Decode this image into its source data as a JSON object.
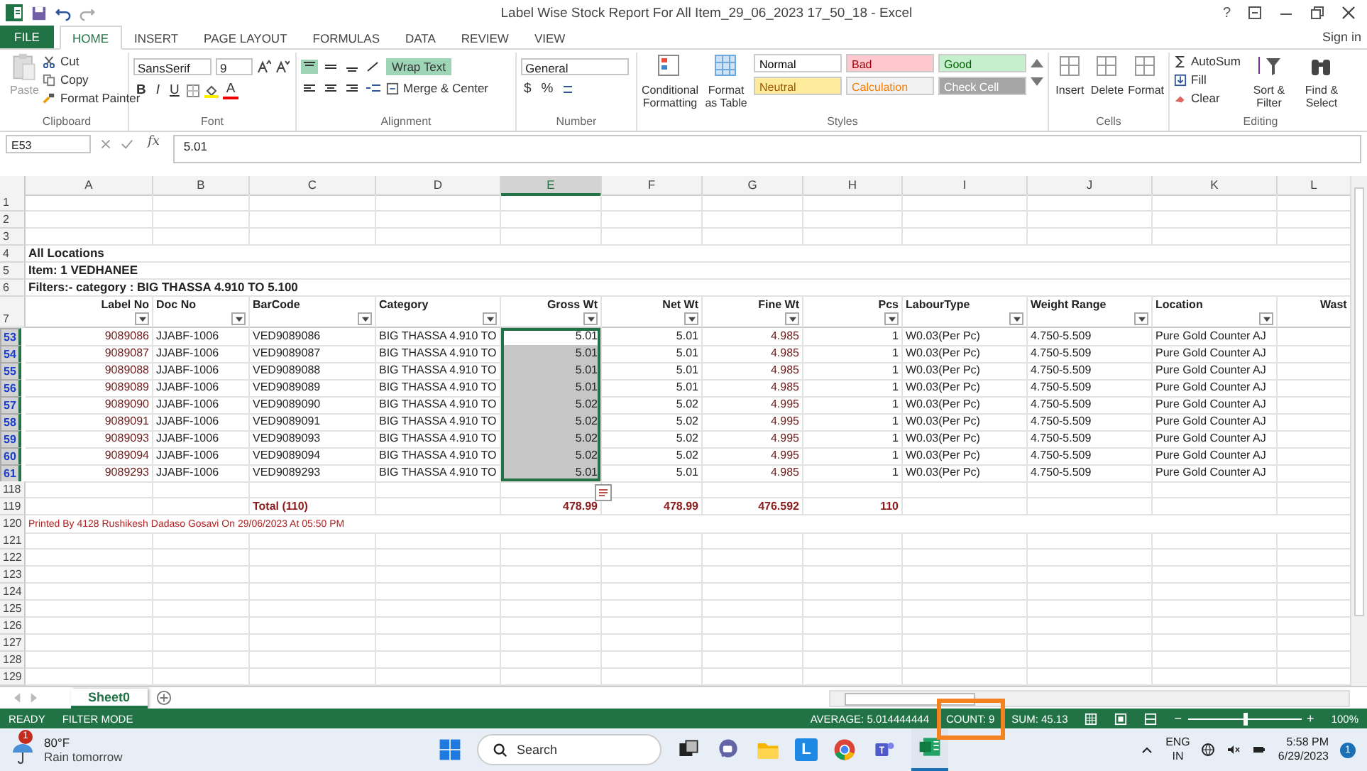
{
  "window": {
    "title": "Label Wise Stock Report For All Item_29_06_2023 17_50_18 - Excel",
    "help": "?",
    "sign_in": "Sign in"
  },
  "tabs": [
    {
      "label": "FILE",
      "kind": "file",
      "selected": false
    },
    {
      "label": "HOME",
      "kind": "tab",
      "selected": true
    },
    {
      "label": "INSERT",
      "kind": "tab",
      "selected": false
    },
    {
      "label": "PAGE LAYOUT",
      "kind": "tab",
      "selected": false
    },
    {
      "label": "FORMULAS",
      "kind": "tab",
      "selected": false
    },
    {
      "label": "DATA",
      "kind": "tab",
      "selected": false
    },
    {
      "label": "REVIEW",
      "kind": "tab",
      "selected": false
    },
    {
      "label": "VIEW",
      "kind": "tab",
      "selected": false
    }
  ],
  "ribbon": {
    "clipboard": {
      "label": "Clipboard",
      "paste": "Paste",
      "cut": "Cut",
      "copy": "Copy",
      "format_painter": "Format Painter"
    },
    "font": {
      "label": "Font",
      "name": "SansSerif",
      "size": "9",
      "bold": "B",
      "italic": "I",
      "underline": "U",
      "font_color": "A"
    },
    "alignment": {
      "label": "Alignment",
      "wrap_text": "Wrap Text",
      "wrap_active": true,
      "merge": "Merge & Center"
    },
    "number": {
      "label": "Number",
      "format": "General",
      "currency": "$",
      "percent": "%"
    },
    "styles": {
      "label": "Styles",
      "conditional": "Conditional Formatting",
      "format_table": "Format as Table",
      "cell_styles": [
        {
          "name": "Normal",
          "color": "#ffffff"
        },
        {
          "name": "Bad",
          "color": "#ffc7ce"
        },
        {
          "name": "Good",
          "color": "#c6efce"
        },
        {
          "name": "Neutral",
          "color": "#ffeb9c"
        },
        {
          "name": "Calculation",
          "color": "#f2f2f2"
        },
        {
          "name": "Check Cell",
          "color": "#a5a5a5"
        }
      ]
    },
    "cells": {
      "label": "Cells",
      "buttons": [
        "Insert",
        "Delete",
        "Format"
      ]
    },
    "editing": {
      "label": "Editing",
      "autosum": "AutoSum",
      "fill": "Fill",
      "clear": "Clear",
      "sort": "Sort & Filter",
      "find": "Find & Select"
    }
  },
  "formula_bar": {
    "name_box": "E53",
    "fx": "fx",
    "value": "5.01"
  },
  "sheet": {
    "columns": [
      {
        "label": "A",
        "selected": false
      },
      {
        "label": "B",
        "selected": false
      },
      {
        "label": "C",
        "selected": false
      },
      {
        "label": "D",
        "selected": false
      },
      {
        "label": "E",
        "selected": true
      },
      {
        "label": "F",
        "selected": false
      },
      {
        "label": "G",
        "selected": false
      },
      {
        "label": "H",
        "selected": false
      },
      {
        "label": "I",
        "selected": false
      },
      {
        "label": "J",
        "selected": false
      },
      {
        "label": "K",
        "selected": false
      },
      {
        "label": "L",
        "selected": false
      }
    ],
    "rows": [
      {
        "num": "1",
        "kind": "blank"
      },
      {
        "num": "2",
        "kind": "blank"
      },
      {
        "num": "3",
        "kind": "blank"
      },
      {
        "num": "4",
        "kind": "title",
        "text": "All Locations"
      },
      {
        "num": "5",
        "kind": "title",
        "text": "Item: 1 VEDHANEE"
      },
      {
        "num": "6",
        "kind": "title",
        "text": "Filters:- category : BIG THASSA 4.910 TO 5.100"
      },
      {
        "num": "7",
        "kind": "header",
        "cells": [
          {
            "text": "Label No",
            "filter": true
          },
          {
            "text": "Doc No",
            "filter": true
          },
          {
            "text": "BarCode",
            "filter": true
          },
          {
            "text": "Category",
            "filter": true
          },
          {
            "text": "Gross Wt",
            "filter": true
          },
          {
            "text": "Net Wt",
            "filter": true
          },
          {
            "text": "Fine Wt",
            "filter": true
          },
          {
            "text": "Pcs",
            "filter": true
          },
          {
            "text": "LabourType",
            "filter": true
          },
          {
            "text": "Weight Range",
            "filter": true
          },
          {
            "text": "Location",
            "filter": true
          },
          {
            "text": "Wast",
            "filter": false
          }
        ]
      },
      {
        "num": "53",
        "kind": "data",
        "filtered": true,
        "selected": true,
        "active": true,
        "cells": [
          "9089086",
          "JJABF-1006",
          "VED9089086",
          "BIG THASSA 4.910 TO",
          "5.01",
          "5.01",
          "4.985",
          "1",
          "W0.03(Per Pc)",
          "4.750-5.509",
          "Pure Gold Counter AJ"
        ]
      },
      {
        "num": "54",
        "kind": "data",
        "filtered": true,
        "selected": true,
        "active": false,
        "cells": [
          "9089087",
          "JJABF-1006",
          "VED9089087",
          "BIG THASSA 4.910 TO",
          "5.01",
          "5.01",
          "4.985",
          "1",
          "W0.03(Per Pc)",
          "4.750-5.509",
          "Pure Gold Counter AJ"
        ]
      },
      {
        "num": "55",
        "kind": "data",
        "filtered": true,
        "selected": true,
        "active": false,
        "cells": [
          "9089088",
          "JJABF-1006",
          "VED9089088",
          "BIG THASSA 4.910 TO",
          "5.01",
          "5.01",
          "4.985",
          "1",
          "W0.03(Per Pc)",
          "4.750-5.509",
          "Pure Gold Counter AJ"
        ]
      },
      {
        "num": "56",
        "kind": "data",
        "filtered": true,
        "selected": true,
        "active": false,
        "cells": [
          "9089089",
          "JJABF-1006",
          "VED9089089",
          "BIG THASSA 4.910 TO",
          "5.01",
          "5.01",
          "4.985",
          "1",
          "W0.03(Per Pc)",
          "4.750-5.509",
          "Pure Gold Counter AJ"
        ]
      },
      {
        "num": "57",
        "kind": "data",
        "filtered": true,
        "selected": true,
        "active": false,
        "cells": [
          "9089090",
          "JJABF-1006",
          "VED9089090",
          "BIG THASSA 4.910 TO",
          "5.02",
          "5.02",
          "4.995",
          "1",
          "W0.03(Per Pc)",
          "4.750-5.509",
          "Pure Gold Counter AJ"
        ]
      },
      {
        "num": "58",
        "kind": "data",
        "filtered": true,
        "selected": true,
        "active": false,
        "cells": [
          "9089091",
          "JJABF-1006",
          "VED9089091",
          "BIG THASSA 4.910 TO",
          "5.02",
          "5.02",
          "4.995",
          "1",
          "W0.03(Per Pc)",
          "4.750-5.509",
          "Pure Gold Counter AJ"
        ]
      },
      {
        "num": "59",
        "kind": "data",
        "filtered": true,
        "selected": true,
        "active": false,
        "cells": [
          "9089093",
          "JJABF-1006",
          "VED9089093",
          "BIG THASSA 4.910 TO",
          "5.02",
          "5.02",
          "4.995",
          "1",
          "W0.03(Per Pc)",
          "4.750-5.509",
          "Pure Gold Counter AJ"
        ]
      },
      {
        "num": "60",
        "kind": "data",
        "filtered": true,
        "selected": true,
        "active": false,
        "cells": [
          "9089094",
          "JJABF-1006",
          "VED9089094",
          "BIG THASSA 4.910 TO",
          "5.02",
          "5.02",
          "4.995",
          "1",
          "W0.03(Per Pc)",
          "4.750-5.509",
          "Pure Gold Counter AJ"
        ]
      },
      {
        "num": "61",
        "kind": "data",
        "filtered": true,
        "selected": true,
        "active": false,
        "cells": [
          "9089293",
          "JJABF-1006",
          "VED9089293",
          "BIG THASSA 4.910 TO",
          "5.01",
          "5.01",
          "4.985",
          "1",
          "W0.03(Per Pc)",
          "4.750-5.509",
          "Pure Gold Counter AJ"
        ]
      },
      {
        "num": "118",
        "kind": "blank"
      },
      {
        "num": "119",
        "kind": "total",
        "label": "Total (110)",
        "gross": "478.99",
        "net": "478.99",
        "fine": "476.592",
        "pcs": "110"
      },
      {
        "num": "120",
        "kind": "note",
        "text": "Printed By 4128 Rushikesh Dadaso Gosavi On 29/06/2023 At 05:50 PM"
      },
      {
        "num": "121",
        "kind": "blank"
      },
      {
        "num": "122",
        "kind": "blank"
      },
      {
        "num": "123",
        "kind": "blank"
      },
      {
        "num": "124",
        "kind": "blank"
      },
      {
        "num": "125",
        "kind": "blank"
      },
      {
        "num": "126",
        "kind": "blank"
      },
      {
        "num": "127",
        "kind": "blank"
      },
      {
        "num": "128",
        "kind": "blank"
      },
      {
        "num": "129",
        "kind": "blank"
      }
    ]
  },
  "sheet_tabs": [
    {
      "label": "Sheet0",
      "selected": true
    }
  ],
  "status_bar": {
    "left": [
      "READY",
      "FILTER MODE"
    ],
    "stats": [
      {
        "text": "AVERAGE: 5.014444444",
        "highlighted": false
      },
      {
        "text": "COUNT: 9",
        "highlighted": true
      },
      {
        "text": "SUM: 45.13",
        "highlighted": false
      }
    ],
    "zoom": {
      "out": "−",
      "level": 0.5,
      "in": "+",
      "text": "100%"
    }
  },
  "taskbar": {
    "weather": {
      "badge": "1",
      "temp": "80°F",
      "forecast": "Rain tomorrow"
    },
    "search": {
      "placeholder": "Search"
    },
    "launcher_letter": "L",
    "tray": {
      "lang": "ENG",
      "region": "IN",
      "time": "5:58 PM",
      "date": "6/29/2023",
      "badge": "1"
    }
  }
}
